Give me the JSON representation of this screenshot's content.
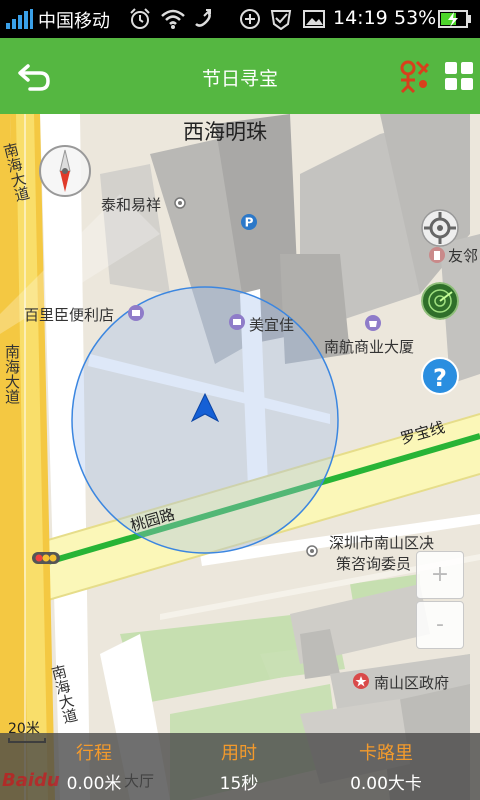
{
  "status_bar": {
    "carrier": "中国移动",
    "time": "14:19",
    "battery": "53%"
  },
  "header": {
    "title": "节日寻宝"
  },
  "map": {
    "labels": {
      "xihai": "西海明珠",
      "taihe": "泰和易祥",
      "bailichen": "百里臣便利店",
      "meiyijia": "美宜佳",
      "nanhang": "南航商业大厦",
      "youlin": "友邻",
      "nanhai_top": "南海大道",
      "nanhai_left": "南海大道",
      "nanhai_bottom": "南海大道",
      "luobao": "罗宝线",
      "taoyuan": "桃园路",
      "juece_1": "深圳市南山区决",
      "juece_2": "策咨询委员",
      "nanshan_gov": "南山区政府",
      "partial_ting": "大厅"
    },
    "scale": "20米",
    "zoom_in": "+",
    "zoom_out": "-",
    "help": "?"
  },
  "stats": [
    {
      "label": "行程",
      "value": "0.00米"
    },
    {
      "label": "用时",
      "value": "15秒"
    },
    {
      "label": "卡路里",
      "value": "0.00大卡"
    }
  ],
  "logo": "Baidu"
}
